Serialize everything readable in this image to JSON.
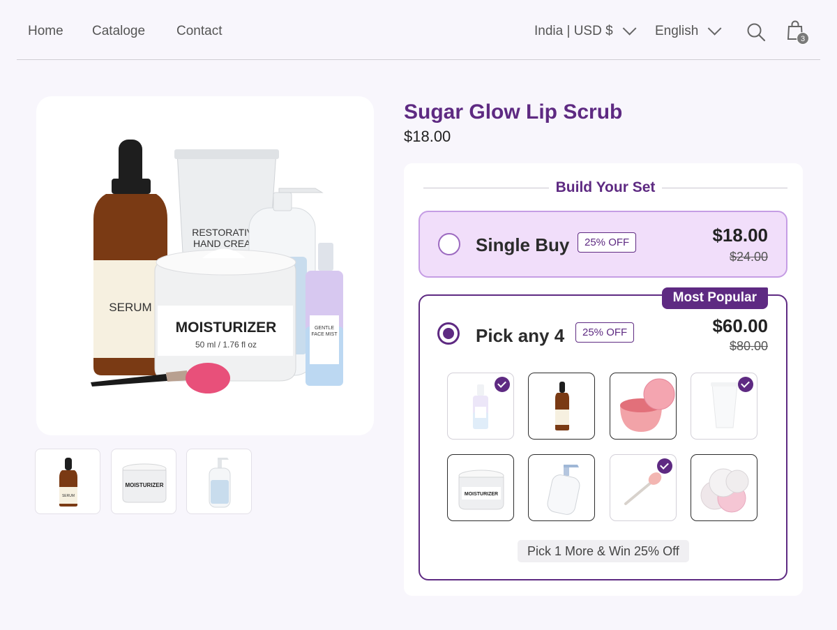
{
  "nav": {
    "links": [
      "Home",
      "Cataloge",
      "Contact"
    ],
    "region": "India | USD $",
    "language": "English",
    "cart_count": "3"
  },
  "main_image": {
    "serum_label": "SERUM",
    "cream_label_1": "RESTORATIVE",
    "cream_label_2": "HAND CREAM",
    "jar_label": "MOISTURIZER",
    "jar_sub": "50 ml / 1.76 fl oz",
    "mist_label_1": "GENTLE",
    "mist_label_2": "FACE MIST"
  },
  "thumbnails": [
    {
      "name": "serum",
      "label": "SERUM"
    },
    {
      "name": "moisturizer",
      "label": "MOISTURIZER"
    },
    {
      "name": "pump-bottle",
      "label": ""
    }
  ],
  "product": {
    "title": "Sugar Glow Lip Scrub",
    "price": "$18.00"
  },
  "builder": {
    "heading": "Build Your Set",
    "single": {
      "label": "Single Buy",
      "badge": "25% OFF",
      "price": "$18.00",
      "old_price": "$24.00",
      "selected": false
    },
    "bundle": {
      "tag": "Most Popular",
      "label": "Pick any 4",
      "badge": "25% OFF",
      "price": "$60.00",
      "old_price": "$80.00",
      "selected": true,
      "promo": "Pick 1 More & Win 25% Off",
      "items": [
        {
          "name": "face-mist",
          "selected": true
        },
        {
          "name": "serum",
          "selected": false
        },
        {
          "name": "lip-scrub",
          "selected": false
        },
        {
          "name": "hand-cream",
          "selected": true
        },
        {
          "name": "moisturizer",
          "selected": false
        },
        {
          "name": "pump-bottle",
          "selected": false
        },
        {
          "name": "makeup-brush",
          "selected": true
        },
        {
          "name": "cotton-pads",
          "selected": false
        }
      ]
    }
  },
  "colors": {
    "brand": "#5e2a82",
    "selected_option_bg": "#f1defa",
    "page_bg": "#f8f6fc"
  }
}
